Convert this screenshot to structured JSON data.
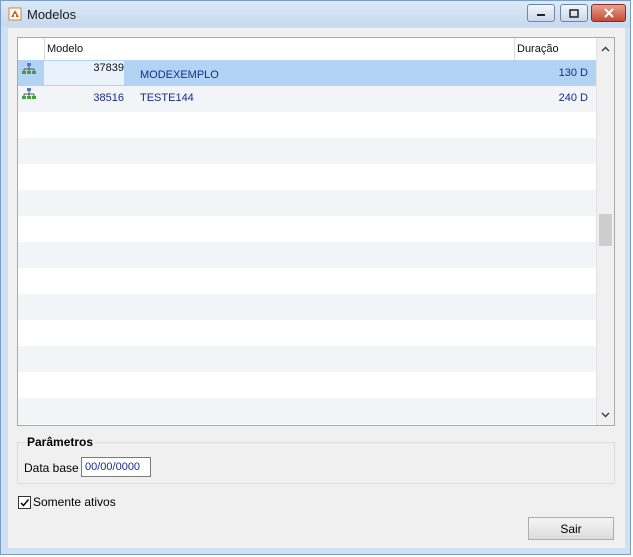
{
  "window": {
    "title": "Modelos"
  },
  "grid": {
    "columns": [
      "Modelo",
      "Duração"
    ],
    "rows": [
      {
        "code": "37839",
        "name": "MODEXEMPLO",
        "duration": "130 D",
        "selected": true
      },
      {
        "code": "38516",
        "name": "TESTE144",
        "duration": "240 D",
        "selected": false
      }
    ],
    "empty_rows": 12
  },
  "params": {
    "title": "Parâmetros",
    "date_label": "Data base",
    "date_value": "00/00/0000"
  },
  "active_only": {
    "label": "Somente ativos",
    "checked": true
  },
  "exit_button": "Sair",
  "colors": {
    "selection": "#b3d3f5",
    "text_blue": "#1a2a8a"
  }
}
